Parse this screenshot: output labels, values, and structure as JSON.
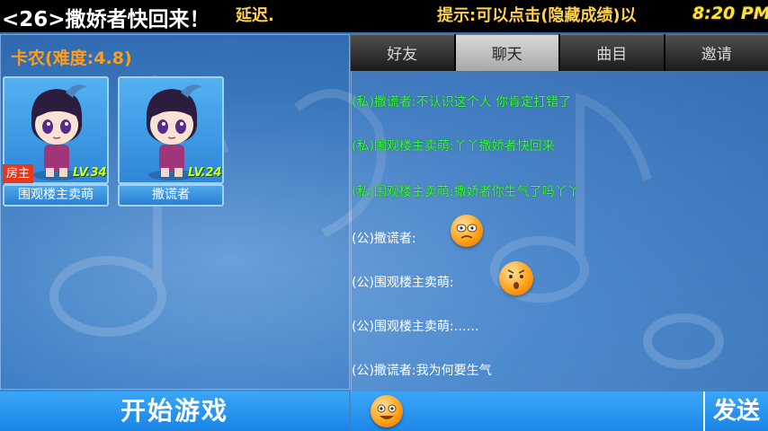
{
  "topbar": {
    "room_title": "<26>撒娇者快回来！",
    "delay": "延迟.",
    "hint": "提示:可以点击(隐藏成绩)以",
    "clock": "8:20 PM"
  },
  "room": {
    "song_title": "卡农(难度:4.8)",
    "players": [
      {
        "name": "围观楼主卖萌",
        "level": "LV.34",
        "host_badge": "房主"
      },
      {
        "name": "撒谎者",
        "level": "LV.24"
      }
    ],
    "start_button": "开始游戏"
  },
  "tabs": [
    {
      "label": "好友",
      "active": false
    },
    {
      "label": "聊天",
      "active": true
    },
    {
      "label": "曲目",
      "active": false
    },
    {
      "label": "邀请",
      "active": false
    }
  ],
  "chat": {
    "messages": [
      {
        "type": "private",
        "text": "(私)撒谎者:不认识这个人 你肯定打错了"
      },
      {
        "type": "private",
        "text": "(私)围观楼主卖萌:丫丫撒娇者快回来"
      },
      {
        "type": "private",
        "text": "(私)围观楼主卖萌:撒娇者你生气了吗丫丫"
      },
      {
        "type": "public",
        "text": "(公)撒谎者:",
        "emoji": "confused-face-emoji"
      },
      {
        "type": "public",
        "text": "(公)围观楼主卖萌:",
        "emoji": "surprised-face-emoji"
      },
      {
        "type": "public",
        "text": "(公)围观楼主卖萌:……"
      },
      {
        "type": "public",
        "text": "(公)撒谎者:我为何要生气"
      }
    ]
  },
  "input": {
    "emoji_icon": "smiley-face-icon",
    "send_button": "发送"
  },
  "colors": {
    "private_message": "#3bff3b",
    "accent_orange": "#ff9c1a",
    "button_blue": "#1a84e6"
  }
}
